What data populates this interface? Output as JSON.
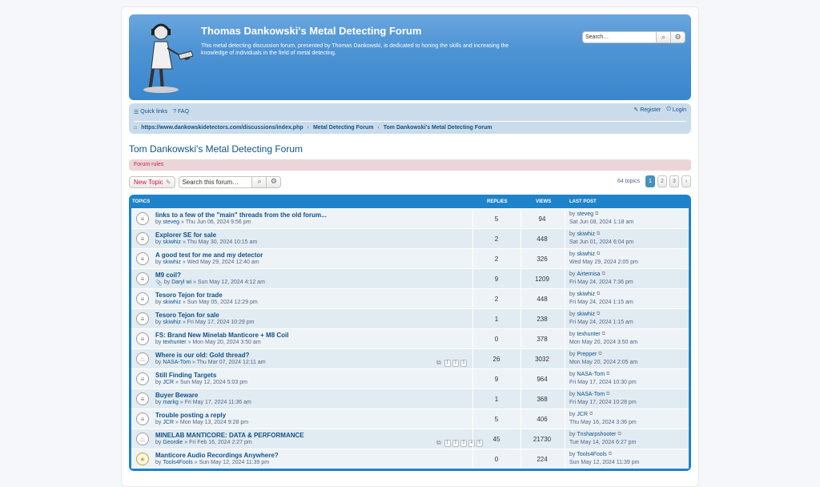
{
  "header": {
    "title": "Thomas Dankowski's Metal Detecting Forum",
    "description": "This metal detecting discussion forum, presented by Thomas Dankowski, is dedicated to honing the skills and increasing the knowledge of individuals in the field of metal detecting.",
    "search_placeholder": "Search…"
  },
  "nav": {
    "quick_links": "Quick links",
    "faq": "FAQ",
    "register": "Register",
    "login": "Login",
    "breadcrumbs": [
      "https://www.dankowskidetectors.com/discussions/index.php",
      "Metal Detecting Forum",
      "Tom Dankowski's Metal Detecting Forum"
    ]
  },
  "forum": {
    "title": "Tom Dankowski's Metal Detecting Forum",
    "rules": "Forum rules",
    "new_topic": "New Topic",
    "search_placeholder": "Search this forum…",
    "topic_count": "64 topics",
    "pages": [
      "1",
      "2",
      "3"
    ]
  },
  "table": {
    "headers": {
      "topics": "TOPICS",
      "replies": "REPLIES",
      "views": "VIEWS",
      "last_post": "LAST POST"
    },
    "rows": [
      {
        "title": "links to a few of the \"main\" threads from the old forum...",
        "by": "by",
        "author": "steveg",
        "date": "» Thu Jun 06, 2024 9:56 pm",
        "replies": "5",
        "views": "94",
        "lp_by": "by",
        "lp_author": "steveg",
        "lp_date": "Sat Jun 08, 2024 1:18 am"
      },
      {
        "title": "Explorer SE for sale",
        "by": "by",
        "author": "skiwhiz",
        "date": "» Thu May 30, 2024 10:15 am",
        "replies": "2",
        "views": "448",
        "lp_by": "by",
        "lp_author": "skiwhiz",
        "lp_date": "Sat Jun 01, 2024 6:04 pm"
      },
      {
        "title": "A good test for me and my detector",
        "by": "by",
        "author": "skiwhiz",
        "date": "» Wed May 29, 2024 12:40 am",
        "replies": "2",
        "views": "326",
        "lp_by": "by",
        "lp_author": "skiwhiz",
        "lp_date": "Wed May 29, 2024 2:05 pm"
      },
      {
        "title": "M9 coil?",
        "by": "by",
        "author": "Daryl wi",
        "date": "» Sun May 12, 2024 4:12 am",
        "replies": "9",
        "views": "1209",
        "lp_by": "by",
        "lp_author": "Airtemisa",
        "lp_date": "Fri May 24, 2024 7:36 pm"
      },
      {
        "title": "Tesoro Tejon for trade",
        "by": "by",
        "author": "skiwhiz",
        "date": "» Sun May 05, 2024 12:29 pm",
        "replies": "2",
        "views": "448",
        "lp_by": "by",
        "lp_author": "skiwhiz",
        "lp_date": "Fri May 24, 2024 1:15 am"
      },
      {
        "title": "Tesoro Tejon for sale",
        "by": "by",
        "author": "skiwhiz",
        "date": "» Fri May 17, 2024 10:29 pm",
        "replies": "1",
        "views": "238",
        "lp_by": "by",
        "lp_author": "skiwhiz",
        "lp_date": "Fri May 24, 2024 1:15 am"
      },
      {
        "title": "FS: Brand New Minelab Manticore + M8 Coil",
        "by": "by",
        "author": "texhunter",
        "date": "» Mon May 20, 2024 3:50 am",
        "replies": "0",
        "views": "378",
        "lp_by": "by",
        "lp_author": "texhunter",
        "lp_date": "Mon May 20, 2024 3:50 am"
      },
      {
        "title": "Where is our old: Gold thread?",
        "by": "by",
        "author": "NASA-Tom",
        "date": "» Thu Mar 07, 2024 12:11 am",
        "replies": "26",
        "views": "3032",
        "lp_by": "by",
        "lp_author": "Prepper",
        "lp_date": "Mon May 20, 2024 2:05 am",
        "mini_pages": [
          "1",
          "2",
          "3"
        ]
      },
      {
        "title": "Still Finding Targets",
        "by": "by",
        "author": "JCR",
        "date": "» Sun May 12, 2024 5:03 pm",
        "replies": "9",
        "views": "964",
        "lp_by": "by",
        "lp_author": "NASA-Tom",
        "lp_date": "Fri May 17, 2024 10:30 pm"
      },
      {
        "title": "Buyer Beware",
        "by": "by",
        "author": "markg",
        "date": "» Fri May 17, 2024 11:36 am",
        "replies": "1",
        "views": "368",
        "lp_by": "by",
        "lp_author": "NASA-Tom",
        "lp_date": "Fri May 17, 2024 10:28 pm"
      },
      {
        "title": "Trouble posting a reply",
        "by": "by",
        "author": "JCR",
        "date": "» Mon May 13, 2024 9:28 pm",
        "replies": "5",
        "views": "406",
        "lp_by": "by",
        "lp_author": "JCR",
        "lp_date": "Thu May 16, 2024 3:36 pm"
      },
      {
        "title": "MINELAB MANTICORE: DATA & PERFORMANCE",
        "by": "by",
        "author": "Geordie",
        "date": "» Fri Feb 16, 2024 2:27 pm",
        "replies": "45",
        "views": "21730",
        "lp_by": "by",
        "lp_author": "Tnsharpshooter",
        "lp_date": "Tue May 14, 2024 6:27 pm",
        "mini_pages": [
          "1",
          "2",
          "3",
          "4",
          "5"
        ]
      },
      {
        "title": "Manticore Audio Recordings Anywhere?",
        "by": "by",
        "author": "Tools4Fools",
        "date": "» Sun May 12, 2024 11:39 pm",
        "replies": "0",
        "views": "224",
        "lp_by": "by",
        "lp_author": "Tools4Fools",
        "lp_date": "Sun May 12, 2024 11:39 pm"
      }
    ]
  }
}
